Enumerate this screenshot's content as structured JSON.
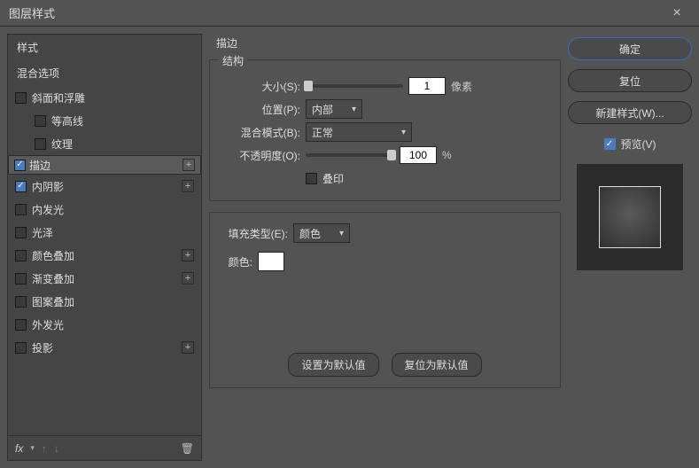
{
  "window": {
    "title": "图层样式",
    "close": "×"
  },
  "left": {
    "header_styles": "样式",
    "header_blend": "混合选项",
    "items": [
      {
        "label": "斜面和浮雕",
        "checked": false,
        "plus": false,
        "sub": false
      },
      {
        "label": "等高线",
        "checked": false,
        "plus": false,
        "sub": true
      },
      {
        "label": "纹理",
        "checked": false,
        "plus": false,
        "sub": true
      },
      {
        "label": "描边",
        "checked": true,
        "plus": true,
        "sub": false,
        "selected": true
      },
      {
        "label": "内阴影",
        "checked": true,
        "plus": true,
        "sub": false
      },
      {
        "label": "内发光",
        "checked": false,
        "plus": false,
        "sub": false
      },
      {
        "label": "光泽",
        "checked": false,
        "plus": false,
        "sub": false
      },
      {
        "label": "颜色叠加",
        "checked": false,
        "plus": true,
        "sub": false
      },
      {
        "label": "渐变叠加",
        "checked": false,
        "plus": true,
        "sub": false
      },
      {
        "label": "图案叠加",
        "checked": false,
        "plus": false,
        "sub": false
      },
      {
        "label": "外发光",
        "checked": false,
        "plus": false,
        "sub": false
      },
      {
        "label": "投影",
        "checked": false,
        "plus": true,
        "sub": false
      }
    ],
    "footer_fx": "fx"
  },
  "mid": {
    "panel_title": "描边",
    "group_struct": "结构",
    "size_label": "大小(S):",
    "size_value": "1",
    "size_unit": "像素",
    "pos_label": "位置(P):",
    "pos_value": "内部",
    "blend_label": "混合模式(B):",
    "blend_value": "正常",
    "opacity_label": "不透明度(O):",
    "opacity_value": "100",
    "opacity_unit": "%",
    "overprint_label": "叠印",
    "fill_label": "填充类型(E):",
    "fill_value": "颜色",
    "color_label": "颜色:",
    "btn_default": "设置为默认值",
    "btn_reset": "复位为默认值"
  },
  "right": {
    "ok": "确定",
    "cancel": "复位",
    "new_style": "新建样式(W)...",
    "preview": "预览(V)"
  }
}
